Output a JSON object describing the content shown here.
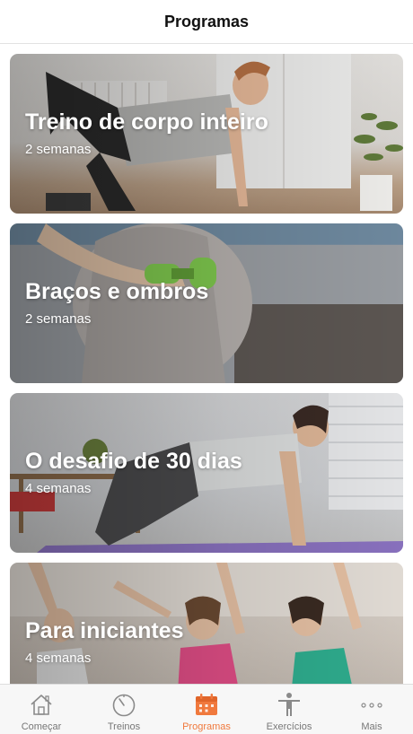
{
  "header": {
    "title": "Programas"
  },
  "programs": [
    {
      "title": "Treino de corpo inteiro",
      "duration": "2 semanas"
    },
    {
      "title": "Braços e ombros",
      "duration": "2 semanas"
    },
    {
      "title": "O desafio de 30 dias",
      "duration": "4 semanas"
    },
    {
      "title": "Para iniciantes",
      "duration": "4 semanas"
    }
  ],
  "tabbar": {
    "items": [
      {
        "label": "Começar",
        "icon": "house-icon",
        "active": false
      },
      {
        "label": "Treinos",
        "icon": "stopwatch-icon",
        "active": false
      },
      {
        "label": "Programas",
        "icon": "calendar-icon",
        "active": true
      },
      {
        "label": "Exercícios",
        "icon": "person-stretch-icon",
        "active": false
      },
      {
        "label": "Mais",
        "icon": "more-dots-icon",
        "active": false
      }
    ]
  },
  "colors": {
    "accent": "#f0793d",
    "inactive": "#777777"
  }
}
